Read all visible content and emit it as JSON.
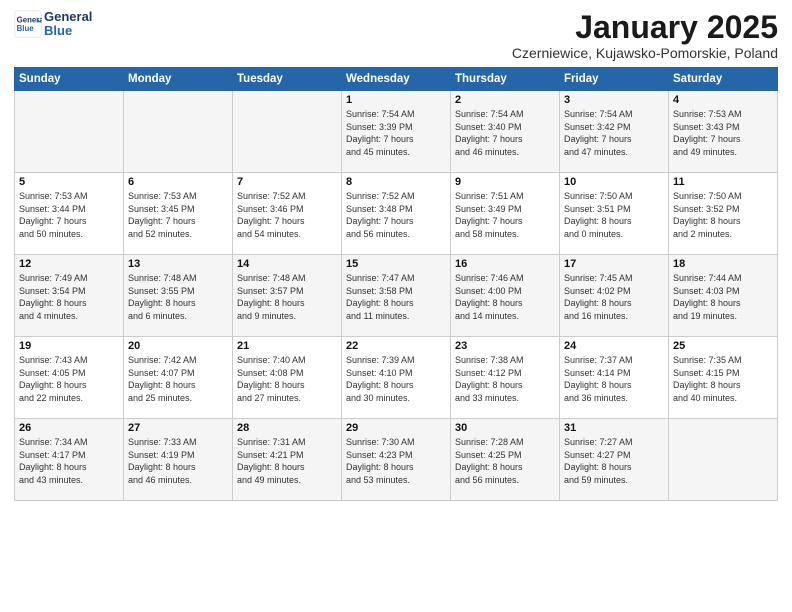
{
  "header": {
    "logo_line1": "General",
    "logo_line2": "Blue",
    "month_title": "January 2025",
    "subtitle": "Czerniewice, Kujawsko-Pomorskie, Poland"
  },
  "days_of_week": [
    "Sunday",
    "Monday",
    "Tuesday",
    "Wednesday",
    "Thursday",
    "Friday",
    "Saturday"
  ],
  "weeks": [
    [
      {
        "day": "",
        "info": ""
      },
      {
        "day": "",
        "info": ""
      },
      {
        "day": "",
        "info": ""
      },
      {
        "day": "1",
        "info": "Sunrise: 7:54 AM\nSunset: 3:39 PM\nDaylight: 7 hours\nand 45 minutes."
      },
      {
        "day": "2",
        "info": "Sunrise: 7:54 AM\nSunset: 3:40 PM\nDaylight: 7 hours\nand 46 minutes."
      },
      {
        "day": "3",
        "info": "Sunrise: 7:54 AM\nSunset: 3:42 PM\nDaylight: 7 hours\nand 47 minutes."
      },
      {
        "day": "4",
        "info": "Sunrise: 7:53 AM\nSunset: 3:43 PM\nDaylight: 7 hours\nand 49 minutes."
      }
    ],
    [
      {
        "day": "5",
        "info": "Sunrise: 7:53 AM\nSunset: 3:44 PM\nDaylight: 7 hours\nand 50 minutes."
      },
      {
        "day": "6",
        "info": "Sunrise: 7:53 AM\nSunset: 3:45 PM\nDaylight: 7 hours\nand 52 minutes."
      },
      {
        "day": "7",
        "info": "Sunrise: 7:52 AM\nSunset: 3:46 PM\nDaylight: 7 hours\nand 54 minutes."
      },
      {
        "day": "8",
        "info": "Sunrise: 7:52 AM\nSunset: 3:48 PM\nDaylight: 7 hours\nand 56 minutes."
      },
      {
        "day": "9",
        "info": "Sunrise: 7:51 AM\nSunset: 3:49 PM\nDaylight: 7 hours\nand 58 minutes."
      },
      {
        "day": "10",
        "info": "Sunrise: 7:50 AM\nSunset: 3:51 PM\nDaylight: 8 hours\nand 0 minutes."
      },
      {
        "day": "11",
        "info": "Sunrise: 7:50 AM\nSunset: 3:52 PM\nDaylight: 8 hours\nand 2 minutes."
      }
    ],
    [
      {
        "day": "12",
        "info": "Sunrise: 7:49 AM\nSunset: 3:54 PM\nDaylight: 8 hours\nand 4 minutes."
      },
      {
        "day": "13",
        "info": "Sunrise: 7:48 AM\nSunset: 3:55 PM\nDaylight: 8 hours\nand 6 minutes."
      },
      {
        "day": "14",
        "info": "Sunrise: 7:48 AM\nSunset: 3:57 PM\nDaylight: 8 hours\nand 9 minutes."
      },
      {
        "day": "15",
        "info": "Sunrise: 7:47 AM\nSunset: 3:58 PM\nDaylight: 8 hours\nand 11 minutes."
      },
      {
        "day": "16",
        "info": "Sunrise: 7:46 AM\nSunset: 4:00 PM\nDaylight: 8 hours\nand 14 minutes."
      },
      {
        "day": "17",
        "info": "Sunrise: 7:45 AM\nSunset: 4:02 PM\nDaylight: 8 hours\nand 16 minutes."
      },
      {
        "day": "18",
        "info": "Sunrise: 7:44 AM\nSunset: 4:03 PM\nDaylight: 8 hours\nand 19 minutes."
      }
    ],
    [
      {
        "day": "19",
        "info": "Sunrise: 7:43 AM\nSunset: 4:05 PM\nDaylight: 8 hours\nand 22 minutes."
      },
      {
        "day": "20",
        "info": "Sunrise: 7:42 AM\nSunset: 4:07 PM\nDaylight: 8 hours\nand 25 minutes."
      },
      {
        "day": "21",
        "info": "Sunrise: 7:40 AM\nSunset: 4:08 PM\nDaylight: 8 hours\nand 27 minutes."
      },
      {
        "day": "22",
        "info": "Sunrise: 7:39 AM\nSunset: 4:10 PM\nDaylight: 8 hours\nand 30 minutes."
      },
      {
        "day": "23",
        "info": "Sunrise: 7:38 AM\nSunset: 4:12 PM\nDaylight: 8 hours\nand 33 minutes."
      },
      {
        "day": "24",
        "info": "Sunrise: 7:37 AM\nSunset: 4:14 PM\nDaylight: 8 hours\nand 36 minutes."
      },
      {
        "day": "25",
        "info": "Sunrise: 7:35 AM\nSunset: 4:15 PM\nDaylight: 8 hours\nand 40 minutes."
      }
    ],
    [
      {
        "day": "26",
        "info": "Sunrise: 7:34 AM\nSunset: 4:17 PM\nDaylight: 8 hours\nand 43 minutes."
      },
      {
        "day": "27",
        "info": "Sunrise: 7:33 AM\nSunset: 4:19 PM\nDaylight: 8 hours\nand 46 minutes."
      },
      {
        "day": "28",
        "info": "Sunrise: 7:31 AM\nSunset: 4:21 PM\nDaylight: 8 hours\nand 49 minutes."
      },
      {
        "day": "29",
        "info": "Sunrise: 7:30 AM\nSunset: 4:23 PM\nDaylight: 8 hours\nand 53 minutes."
      },
      {
        "day": "30",
        "info": "Sunrise: 7:28 AM\nSunset: 4:25 PM\nDaylight: 8 hours\nand 56 minutes."
      },
      {
        "day": "31",
        "info": "Sunrise: 7:27 AM\nSunset: 4:27 PM\nDaylight: 8 hours\nand 59 minutes."
      },
      {
        "day": "",
        "info": ""
      }
    ]
  ]
}
